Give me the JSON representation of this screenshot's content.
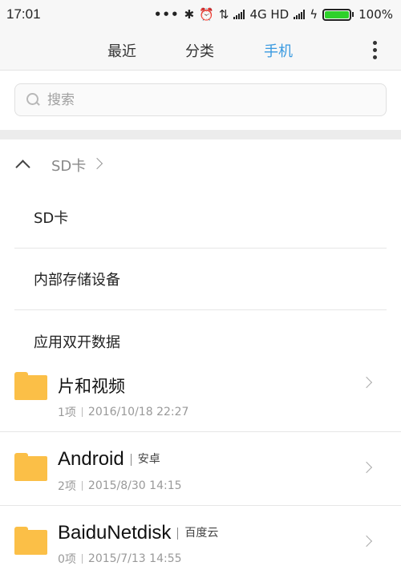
{
  "status_bar": {
    "time": "17:01",
    "network": "4G HD",
    "battery": "100%",
    "battery_level": 1.0,
    "icons": [
      "more-dots-icon",
      "bluetooth-icon",
      "alarm-icon",
      "data-transfer-icon",
      "signal-icon",
      "signal-icon",
      "charging-icon",
      "battery-icon"
    ],
    "battery_color": "#2ed12a"
  },
  "tabs": [
    {
      "label": "最近",
      "active": false
    },
    {
      "label": "分类",
      "active": false
    },
    {
      "label": "手机",
      "active": true
    }
  ],
  "accent_color": "#3a9ae0",
  "search": {
    "placeholder": "搜索"
  },
  "breadcrumb": {
    "label": "SD卡"
  },
  "storage_menu": [
    {
      "label": "SD卡"
    },
    {
      "label": "内部存储设备"
    },
    {
      "label": "应用双开数据"
    }
  ],
  "files": [
    {
      "name": "片和视频",
      "alias": "",
      "count": "1项",
      "date": "2016/10/18 22:27"
    },
    {
      "name": "Android",
      "alias": "安卓",
      "count": "2项",
      "date": "2015/8/30 14:15"
    },
    {
      "name": "BaiduNetdisk",
      "alias": "百度云",
      "count": "0项",
      "date": "2015/7/13 14:55"
    }
  ],
  "folder_color": "#fbbf47"
}
